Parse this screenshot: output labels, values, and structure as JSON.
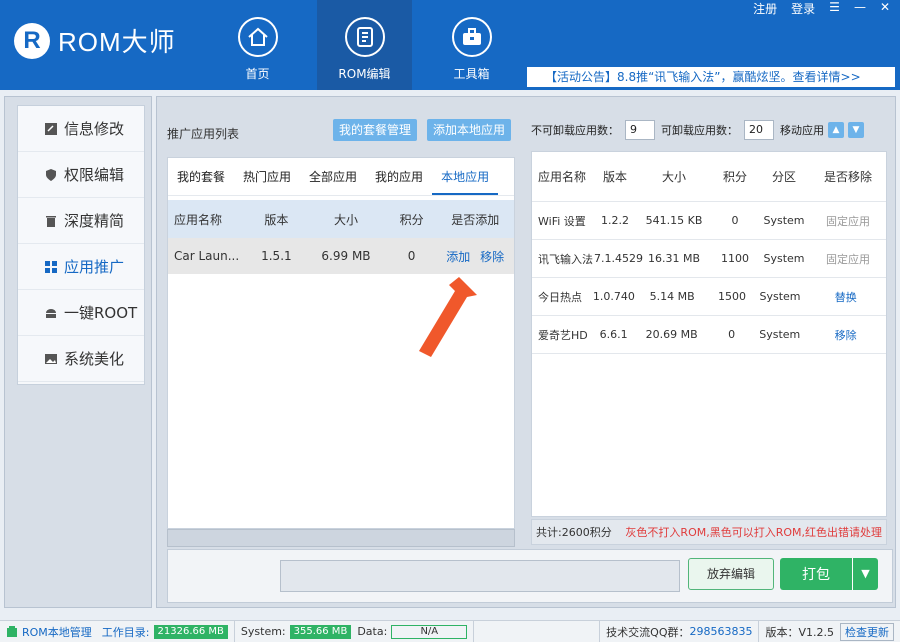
{
  "app": {
    "brand_mark": "R",
    "brand_name": "ROM大师"
  },
  "window_controls": {
    "register": "注册",
    "login": "登录",
    "menu": "☰",
    "minimize": "—",
    "close": "✕"
  },
  "nav": [
    {
      "label": "首页",
      "icon": "home-icon"
    },
    {
      "label": "ROM编辑",
      "icon": "rom-edit-icon",
      "active": true
    },
    {
      "label": "工具箱",
      "icon": "toolbox-icon"
    }
  ],
  "notice": "【活动公告】8.8推“讯飞输入法”，赢酷炫坚。查看详情>>",
  "sidebar": {
    "items": [
      {
        "label": "信息修改",
        "icon": "info-edit-icon"
      },
      {
        "label": "权限编辑",
        "icon": "shield-icon"
      },
      {
        "label": "深度精简",
        "icon": "trash-icon"
      },
      {
        "label": "应用推广",
        "icon": "apps-grid-icon",
        "active": true
      },
      {
        "label": "一键ROOT",
        "icon": "android-icon"
      },
      {
        "label": "系统美化",
        "icon": "image-icon"
      }
    ]
  },
  "left_panel": {
    "title": "推广应用列表",
    "btn_package_manage": "我的套餐管理",
    "btn_add_local": "添加本地应用",
    "tabs": [
      "我的套餐",
      "热门应用",
      "全部应用",
      "我的应用",
      "本地应用"
    ],
    "active_tab": 4,
    "columns": [
      "应用名称",
      "版本",
      "大小",
      "积分",
      "是否添加"
    ],
    "rows": [
      {
        "name": "Car Laun...",
        "version": "1.5.1",
        "size": "6.99 MB",
        "points": "0",
        "action_add": "添加",
        "action_remove": "移除"
      }
    ]
  },
  "right_panel": {
    "label_unremovable": "不可卸载应用数：",
    "unremovable_count": "9",
    "label_removable": "可卸载应用数：",
    "removable_count": "20",
    "label_move": "移动应用",
    "up": "▲",
    "down": "▼",
    "columns": [
      "应用名称",
      "版本",
      "大小",
      "积分",
      "分区",
      "是否移除"
    ],
    "rows": [
      {
        "name": "WiFi 设置",
        "version": "1.2.2",
        "size": "541.15 KB",
        "points": "0",
        "partition": "System",
        "action": "固定应用",
        "action_style": "gray"
      },
      {
        "name": "讯飞输入法",
        "version": "7.1.4529",
        "size": "16.31 MB",
        "points": "1100",
        "partition": "System",
        "action": "固定应用",
        "action_style": "gray"
      },
      {
        "name": "今日热点",
        "version": "1.0.740",
        "size": "5.14 MB",
        "points": "1500",
        "partition": "System",
        "action": "替换",
        "action_style": "blue"
      },
      {
        "name": "爱奇艺HD",
        "version": "6.6.1",
        "size": "20.69 MB",
        "points": "0",
        "partition": "System",
        "action": "移除",
        "action_style": "blue"
      }
    ],
    "total": "共计:2600积分",
    "legend_note": "灰色不打入ROM,黑色可以打入ROM,红色出错请处理"
  },
  "actions": {
    "discard": "放弃编辑",
    "pack": "打包",
    "pack_dropdown": "▼"
  },
  "statusbar": {
    "rom_local": "ROM本地管理",
    "work_dir_label": "工作目录:",
    "work_dir_value": "21326.66 MB",
    "system_label": "System:",
    "system_value": "355.66 MB",
    "data_label": "Data:",
    "data_value": "N/A",
    "qq_label": "技术交流QQ群：",
    "qq_value": "298563835",
    "version": "版本：V1.2.5",
    "check_update": "检查更新"
  }
}
